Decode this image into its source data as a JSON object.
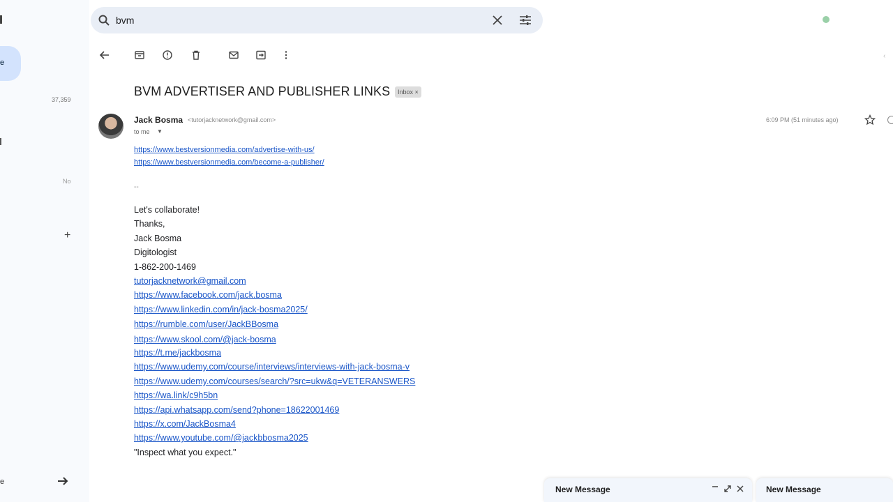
{
  "sidebar": {
    "active_label": "e",
    "count": "37,359",
    "badge": "No",
    "add_label": "+",
    "bottom_label": "e"
  },
  "search": {
    "query": "bvm"
  },
  "toolbar": {
    "icons": [
      "back-arrow-icon",
      "archive-icon",
      "report-spam-icon",
      "delete-icon",
      "mark-unread-icon",
      "move-to-icon",
      "more-vertical-icon"
    ]
  },
  "email": {
    "subject": "BVM ADVERTISER AND PUBLISHER LINKS",
    "label": "Inbox ×",
    "sender_name": "Jack Bosma",
    "sender_email": "<tutorjacknetwork@gmail.com>",
    "to": "to me",
    "timestamp": "6:09 PM (51 minutes ago)",
    "top_links": [
      "https://www.bestversionmedia.com/advertise-with-us/",
      "https://www.bestversionmedia.com/become-a-publisher/"
    ],
    "separator": "--",
    "signature_lines": [
      "Let's collaborate!",
      "Thanks,",
      "Jack Bosma",
      "Digitologist",
      "1-862-200-1469"
    ],
    "signature_links": [
      "tutorjacknetwork@gmail.com",
      "https://www.facebook.com/jack.bosma",
      "https://www.linkedin.com/in/jack-bosma2025/",
      "https://rumble.com/user/JackBBosma",
      "https://www.skool.com/@jack-bosma",
      "https://t.me/jackbosma",
      "https://www.udemy.com/course/interviews/interviews-with-jack-bosma-v",
      "https://www.udemy.com/courses/search/?src=ukw&q=VETERANSWERS",
      "https://wa.link/c9h5bn",
      "https://api.whatsapp.com/send?phone=18622001469",
      "https://x.com/JackBosma4",
      "https://www.youtube.com/@jackbbosma2025"
    ],
    "quote": "\"Inspect what you expect.\""
  },
  "compose": [
    {
      "title": "New Message"
    },
    {
      "title": "New Message"
    }
  ],
  "colors": {
    "link": "#1a56c8",
    "search_bg": "#e9eef6",
    "sidebar_active": "#d3e3fd",
    "compose_bg": "#f2f6fc"
  }
}
